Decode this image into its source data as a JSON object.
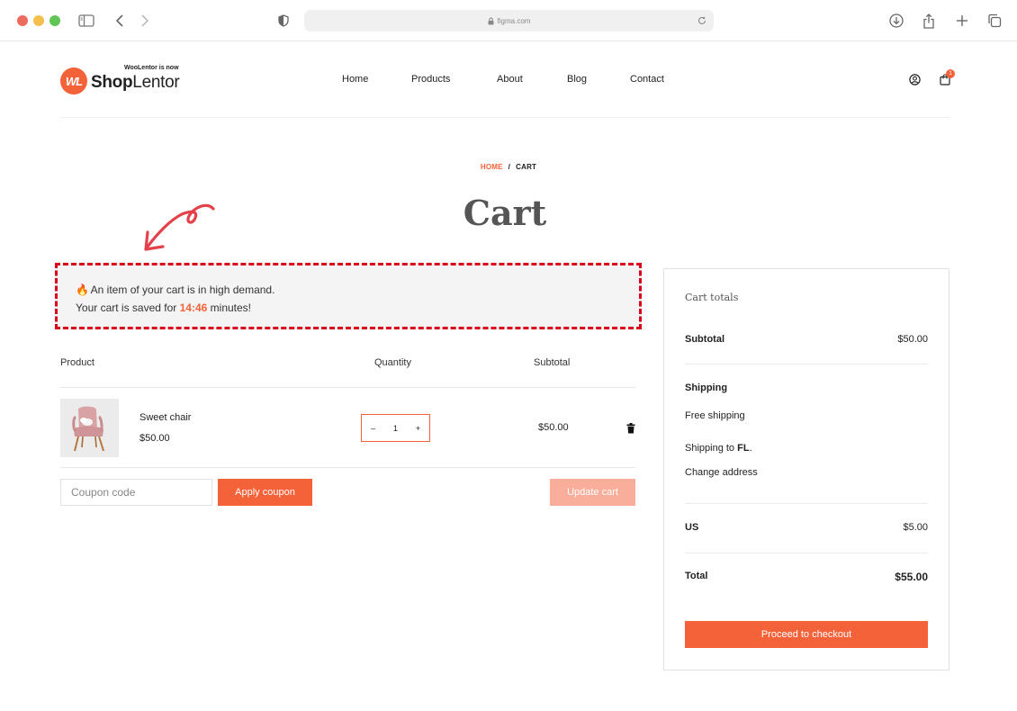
{
  "browser": {
    "url": "figma.com",
    "icons": [
      "sidebar-icon",
      "back-icon",
      "forward-icon",
      "shield-icon",
      "lock-icon",
      "reload-icon",
      "download-icon",
      "share-icon",
      "new-tab-icon",
      "tabs-icon"
    ]
  },
  "header": {
    "logo_badge": "WL",
    "logo_sub": "WooLentor is now",
    "logo_bold": "Shop",
    "logo_normal": "Lentor",
    "nav": [
      "Home",
      "Products",
      "About",
      "Blog",
      "Contact"
    ],
    "cart_count": "1"
  },
  "breadcrumb": {
    "home": "HOME",
    "separator": "/",
    "current": "CART"
  },
  "page_title": "Cart",
  "notice": {
    "icon": "🔥",
    "line1": "An item of your cart is in high demand.",
    "line2_prefix": "Your cart is saved for ",
    "timer": "14:46",
    "line2_suffix": " minutes!"
  },
  "table": {
    "headers": {
      "product": "Product",
      "quantity": "Quantity",
      "subtotal": "Subtotal"
    },
    "items": [
      {
        "name": "Sweet chair",
        "price": "$50.00",
        "quantity": "1",
        "subtotal": "$50.00"
      }
    ],
    "qty_minus": "–",
    "qty_plus": "+"
  },
  "coupon": {
    "placeholder": "Coupon code",
    "apply_label": "Apply coupon",
    "update_label": "Update cart"
  },
  "totals": {
    "title": "Cart totals",
    "subtotal_label": "Subtotal",
    "subtotal_value": "$50.00",
    "shipping_label": "Shipping",
    "shipping_method": "Free shipping",
    "shipping_to_prefix": "Shipping to ",
    "shipping_to_state": "FL",
    "shipping_to_suffix": ".",
    "change_address": "Change address",
    "tax_label": "US",
    "tax_value": "$5.00",
    "total_label": "Total",
    "total_value": "$55.00",
    "checkout_label": "Proceed to checkout"
  },
  "colors": {
    "accent": "#f4623a",
    "accent_light": "#f8ae9a",
    "notice_border": "#d9001b"
  }
}
